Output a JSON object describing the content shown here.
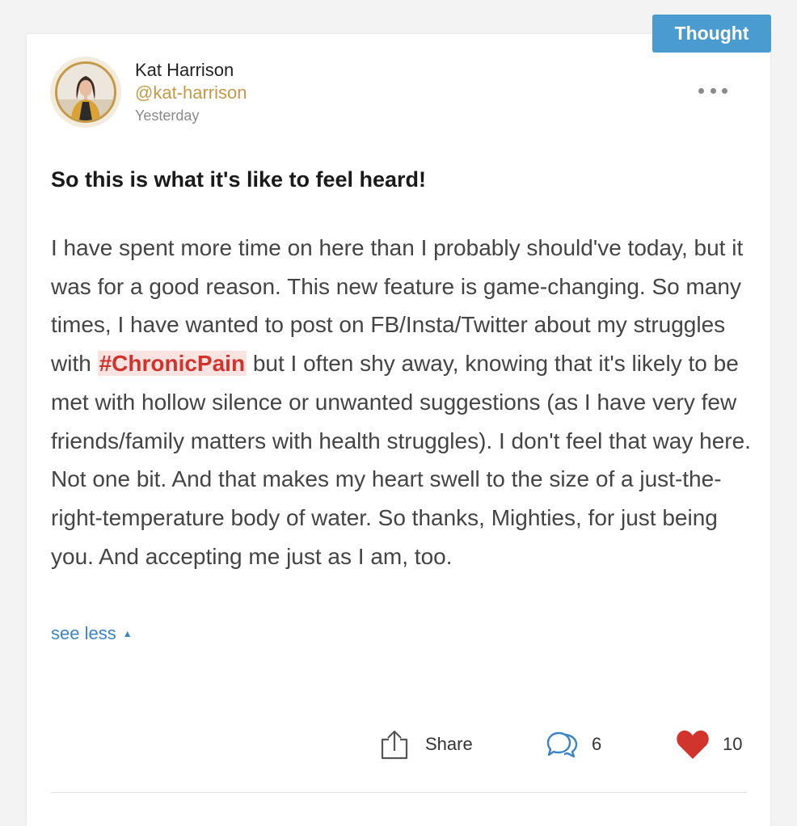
{
  "post": {
    "category_tag": "Thought",
    "author": {
      "name": "Kat Harrison",
      "handle": "@kat-harrison",
      "time": "Yesterday"
    },
    "title": "So this is what it's like to feel heard!",
    "body_part1": "I have spent more time on here than I probably should've today, but it was for a good reason. This new feature is game-changing. So many times, I have wanted to post on FB/Insta/Twitter about my struggles with ",
    "hashtag": "#ChronicPain",
    "body_part2": " but I often shy away, knowing that it's likely to be met with hollow silence or unwanted suggestions (as I have very few friends/family matters with health struggles). I don't feel that way here. Not one bit. And that makes my heart swell to the size of a just-the-right-temperature body of water. So thanks, Mighties, for just being you. And accepting me just as I am, too.",
    "see_less_label": "see less",
    "actions": {
      "share_label": "Share",
      "comment_count": "6",
      "like_count": "10"
    },
    "icons": {
      "menu": "more-dots-icon",
      "share": "share-icon",
      "comment": "comment-bubbles-icon",
      "like": "heart-icon",
      "caret": "caret-up-icon"
    },
    "colors": {
      "tag_background": "#4a9bd0",
      "handle": "#c49a47",
      "hashtag_text": "#d0342c",
      "hashtag_background": "#fbe3e2",
      "link": "#3a84c9",
      "heart": "#d0342c",
      "comment_icon": "#3a84c9"
    }
  }
}
